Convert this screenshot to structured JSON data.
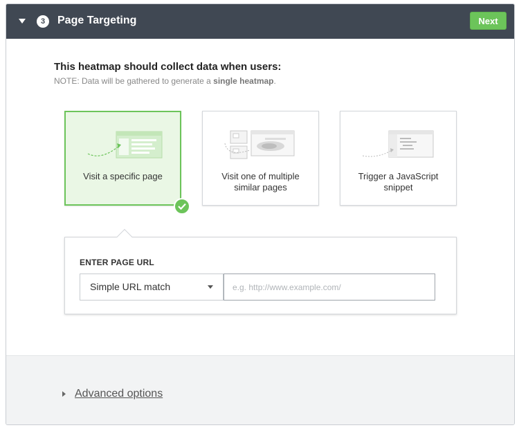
{
  "header": {
    "step_number": "3",
    "title": "Page Targeting",
    "next_label": "Next"
  },
  "intro": {
    "heading": "This heatmap should collect data when users:",
    "note_prefix": "NOTE: Data will be gathered to generate a ",
    "note_bold": "single heatmap",
    "note_suffix": "."
  },
  "options": [
    {
      "label": "Visit a specific page",
      "selected": true
    },
    {
      "label": "Visit one of multiple similar pages",
      "selected": false
    },
    {
      "label": "Trigger a JavaScript snippet",
      "selected": false
    }
  ],
  "url_entry": {
    "label": "ENTER PAGE URL",
    "match_type": "Simple URL match",
    "url_value": "",
    "url_placeholder": "e.g. http://www.example.com/"
  },
  "footer": {
    "advanced_label": "Advanced options"
  },
  "colors": {
    "header_bg": "#404853",
    "accent_green": "#6cc45a",
    "selected_bg": "#eaf7e5"
  }
}
